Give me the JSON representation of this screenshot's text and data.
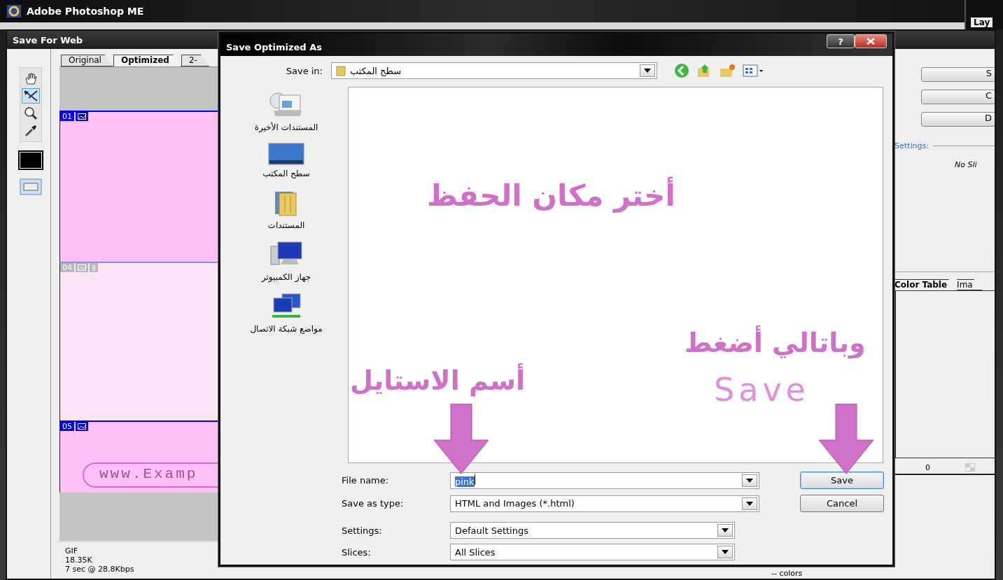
{
  "app": {
    "title": "Adobe Photoshop ME"
  },
  "corner_panel": {
    "tab": "Lay"
  },
  "save_for_web": {
    "title": "Save For Web",
    "tools": [
      {
        "kind": "hand",
        "selected": false
      },
      {
        "kind": "slice_select",
        "selected": true
      },
      {
        "kind": "zoom",
        "selected": false
      },
      {
        "kind": "eyedropper",
        "selected": false
      }
    ],
    "tabs": [
      {
        "label": "Original",
        "selected": false
      },
      {
        "label": "Optimized",
        "selected": true
      },
      {
        "label": "2-",
        "selected": false
      }
    ],
    "slices": [
      {
        "number": "01",
        "selected": true,
        "kind": "plain"
      },
      {
        "number": "04",
        "selected": false,
        "kind": "linked"
      },
      {
        "number": "05",
        "selected": true,
        "kind": "banner",
        "banner": "www.Examp"
      }
    ],
    "info": [
      "GIF",
      "18.35K",
      "7 sec @ 28.8Kbps"
    ],
    "colors": "-- colors",
    "right_panel": {
      "buttons": [
        "S",
        "C",
        "D"
      ],
      "settings_label": "Settings:",
      "slice_note": "No Sli",
      "tabs": [
        {
          "label": "Color Table",
          "selected": true
        },
        {
          "label": "Ima",
          "selected": false
        }
      ],
      "count": "0"
    }
  },
  "dialog": {
    "title": "Save Optimized As",
    "help": "?",
    "save_in": {
      "label": "Save in:",
      "value": "سطح المكتب"
    },
    "places": [
      {
        "kind": "recent",
        "label": "المستندات الأخيرة"
      },
      {
        "kind": "desktop",
        "label": "سطح المكتب"
      },
      {
        "kind": "documents",
        "label": "المستندات"
      },
      {
        "kind": "computer",
        "label": "جهاز الكمبيوتر"
      },
      {
        "kind": "network",
        "label": "مواضع شبكة الاتصال"
      }
    ],
    "file_fields": [
      {
        "label": "File name:",
        "value": "pink",
        "kind": "text"
      },
      {
        "label": "Save as type:",
        "value": "HTML and Images (*.html)",
        "kind": "combo"
      }
    ],
    "option_fields": [
      {
        "label": "Settings:",
        "value": "Default Settings",
        "kind": "combo"
      },
      {
        "label": "Slices:",
        "value": "All Slices",
        "kind": "combo"
      }
    ],
    "buttons": [
      {
        "label": "Save",
        "default": true
      },
      {
        "label": "Cancel",
        "default": false
      }
    ],
    "annotations": [
      {
        "text": "أختر مكان الحفظ"
      },
      {
        "text": "وباتالي أضغط"
      },
      {
        "text": "Save"
      },
      {
        "text": "أسم الاستايل"
      }
    ]
  }
}
